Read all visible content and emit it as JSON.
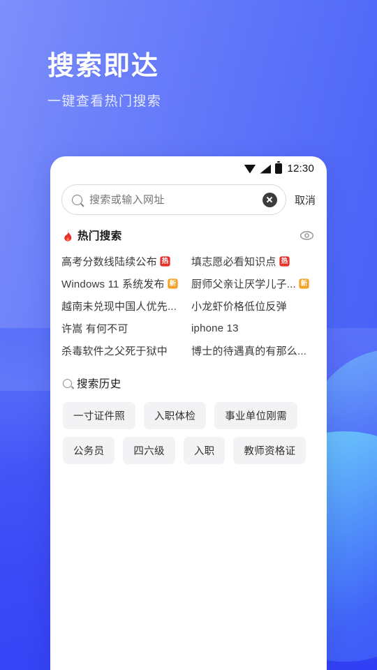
{
  "hero": {
    "title": "搜索即达",
    "subtitle": "一键查看热门搜索"
  },
  "phone": {
    "statusbar": {
      "time": "12:30",
      "wifi_icon": "wifi-icon",
      "signal_icon": "signal-icon",
      "battery_icon": "battery-icon"
    },
    "search": {
      "placeholder": "搜索或输入网址",
      "value": "",
      "search_icon": "search-icon",
      "clear_icon": "clear-icon",
      "cancel_label": "取消"
    },
    "hot": {
      "title": "热门搜索",
      "flame_icon": "flame-icon",
      "eye_icon": "eye-icon",
      "items": [
        {
          "text": "高考分数线陆续公布",
          "badge": "热",
          "badge_type": "hot"
        },
        {
          "text": "填志愿必看知识点",
          "badge": "热",
          "badge_type": "hot"
        },
        {
          "text": "Windows 11 系统发布",
          "badge": "新",
          "badge_type": "new"
        },
        {
          "text": "厨师父亲让厌学儿子...",
          "badge": "新",
          "badge_type": "new"
        },
        {
          "text": "越南未兑现中国人优先...",
          "badge": "",
          "badge_type": ""
        },
        {
          "text": "小龙虾价格低位反弹",
          "badge": "",
          "badge_type": ""
        },
        {
          "text": "许嵩 有何不可",
          "badge": "",
          "badge_type": ""
        },
        {
          "text": "iphone 13",
          "badge": "",
          "badge_type": ""
        },
        {
          "text": "杀毒软件之父死于狱中",
          "badge": "",
          "badge_type": ""
        },
        {
          "text": "博士的待遇真的有那么...",
          "badge": "",
          "badge_type": ""
        }
      ]
    },
    "history": {
      "title": "搜索历史",
      "search_icon": "search-icon",
      "chips": [
        "一寸证件照",
        "入职体检",
        "事业单位刚需",
        "公务员",
        "四六级",
        "入职",
        "教师资格证"
      ]
    }
  },
  "colors": {
    "bg_top_left": "#7e8ffb",
    "bg_bottom": "#3240f5",
    "deco_cyan": "#7fd8fb",
    "badge_hot": "#e8302b",
    "badge_new": "#f6a226",
    "flame_red": "#e8302b",
    "card_bg": "#ffffff",
    "chip_bg": "#f3f3f5"
  }
}
